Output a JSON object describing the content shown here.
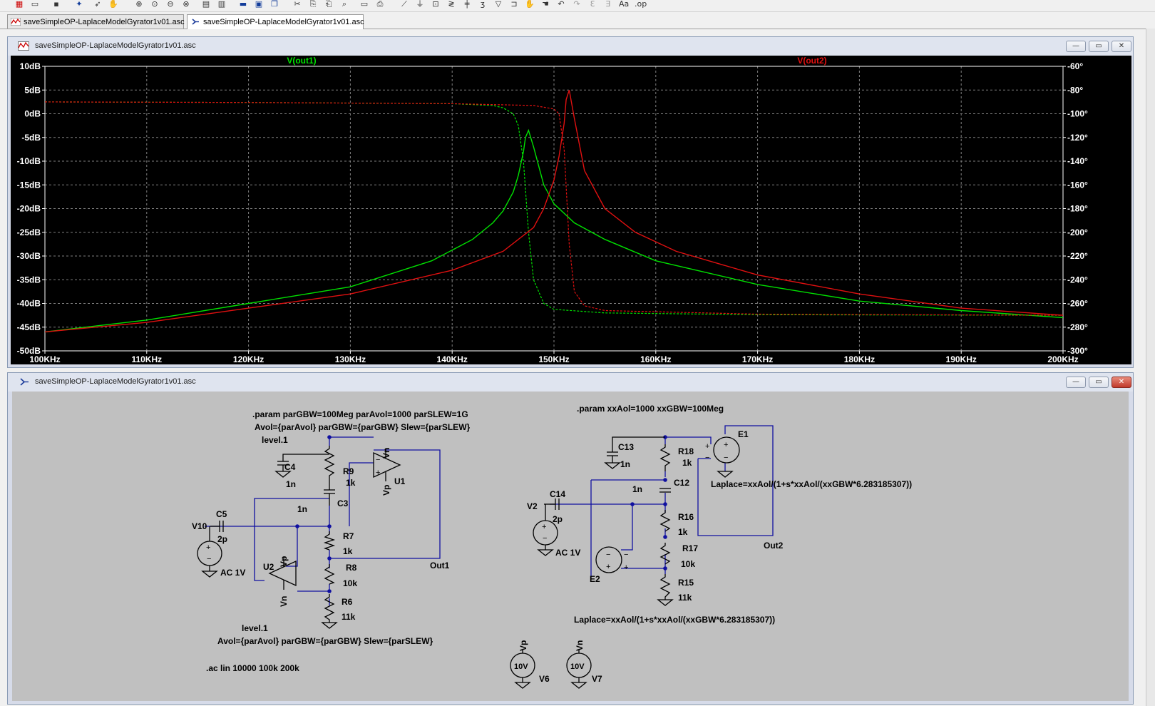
{
  "tabs": [
    {
      "label": "saveSimpleOP-LaplaceModelGyrator1v01.asc",
      "kind": "waveform"
    },
    {
      "label": "saveSimpleOP-LaplaceModelGyrator1v01.asc",
      "kind": "schematic"
    }
  ],
  "plot_window": {
    "title": "saveSimpleOP-LaplaceModelGyrator1v01.asc",
    "controls": {
      "minimize": "—",
      "restore": "▭",
      "close": "✕"
    }
  },
  "schematic_window": {
    "title": "saveSimpleOP-LaplaceModelGyrator1v01.asc",
    "controls": {
      "minimize": "—",
      "restore": "▭",
      "close": "✕"
    }
  },
  "colors": {
    "trace1": "#00e000",
    "trace2": "#e01010",
    "grid": "#808080",
    "axis_text": "#ffffff",
    "plot_bg": "#000000",
    "wire": "#1010a0",
    "schematic_bg": "#c0c0c0"
  },
  "chart_data": {
    "type": "line",
    "xlabel": "",
    "ylabel": "",
    "x_scale": "linear",
    "x_ticks": [
      "100KHz",
      "110KHz",
      "120KHz",
      "130KHz",
      "140KHz",
      "150KHz",
      "160KHz",
      "170KHz",
      "180KHz",
      "190KHz",
      "200KHz"
    ],
    "xlim": [
      100,
      200
    ],
    "y_ticks_left": [
      "10dB",
      "5dB",
      "0dB",
      "-5dB",
      "-10dB",
      "-15dB",
      "-20dB",
      "-25dB",
      "-30dB",
      "-35dB",
      "-40dB",
      "-45dB",
      "-50dB"
    ],
    "ylim_left": [
      -50,
      10
    ],
    "y_ticks_right": [
      "-60°",
      "-80°",
      "-100°",
      "-120°",
      "-140°",
      "-160°",
      "-180°",
      "-200°",
      "-220°",
      "-240°",
      "-260°",
      "-280°",
      "-300°"
    ],
    "ylim_right": [
      -300,
      -60
    ],
    "grid": true,
    "series": [
      {
        "name": "V(out1)",
        "color": "#00e000",
        "magnitude_db": {
          "x": [
            100,
            110,
            120,
            130,
            138,
            142,
            144,
            145,
            146,
            146.5,
            147,
            147.2,
            147.5,
            148,
            149,
            150,
            152,
            155,
            160,
            170,
            180,
            190,
            200
          ],
          "y": [
            -46,
            -43.5,
            -40,
            -36.5,
            -31,
            -26.5,
            -23,
            -20.5,
            -16.5,
            -13,
            -8,
            -5,
            -3.5,
            -7,
            -15,
            -19,
            -23,
            -26.5,
            -31,
            -36,
            -39.5,
            -41.5,
            -43
          ]
        },
        "phase_deg": {
          "x": [
            100,
            120,
            140,
            144,
            145,
            146,
            146.5,
            147,
            147.5,
            148,
            149,
            150,
            155,
            170,
            200
          ],
          "y": [
            -90,
            -90.5,
            -91.5,
            -93,
            -95,
            -100,
            -110,
            -140,
            -200,
            -240,
            -260,
            -265,
            -268,
            -269.5,
            -270
          ]
        }
      },
      {
        "name": "V(out2)",
        "color": "#e01010",
        "magnitude_db": {
          "x": [
            100,
            110,
            120,
            130,
            140,
            145,
            148,
            149,
            150,
            150.5,
            151,
            151.2,
            151.5,
            152,
            153,
            155,
            158,
            162,
            170,
            180,
            190,
            200
          ],
          "y": [
            -46,
            -44,
            -41,
            -38,
            -33,
            -29,
            -24,
            -20,
            -14,
            -9,
            -2,
            3,
            5,
            -1,
            -12,
            -20,
            -25,
            -29,
            -34,
            -38,
            -41,
            -42.5
          ]
        },
        "phase_deg": {
          "x": [
            100,
            120,
            140,
            148,
            150,
            150.5,
            151,
            151.5,
            152,
            153,
            155,
            170,
            200
          ],
          "y": [
            -90,
            -90.5,
            -91.5,
            -93,
            -96,
            -100,
            -130,
            -210,
            -250,
            -262,
            -266,
            -269,
            -270
          ]
        }
      }
    ]
  },
  "schematic": {
    "labels": {
      "param1": ".param parGBW=100Meg parAvol=1000 parSLEW=1G",
      "avol1": "Avol={parAvol} parGBW={parGBW} Slew={parSLEW}",
      "level1": "level.1",
      "level2": "level.1",
      "avol2": "Avol={parAvol} parGBW={parGBW} Slew={parSLEW}",
      "ac_cmd": ".ac lin 10000 100k 200k",
      "param2": ".param xxAol=1000 xxGBW=100Meg",
      "laplace1": "Laplace=xxAol/(1+s*xxAol/(xxGBW*6.283185307))",
      "laplace2": "Laplace=xxAol/(1+s*xxAol/(xxGBW*6.283185307))",
      "out1": "Out1",
      "out2": "Out2"
    },
    "components": {
      "C4": {
        "name": "C4",
        "value": "1n"
      },
      "R9": {
        "name": "R9",
        "value": "1k"
      },
      "C3": {
        "name": "C3",
        "value": "1n"
      },
      "C5": {
        "name": "C5",
        "value": "2p"
      },
      "V10": {
        "name": "V10",
        "value": "AC 1V"
      },
      "R7": {
        "name": "R7",
        "value": "1k"
      },
      "R8": {
        "name": "R8",
        "value": "10k"
      },
      "R6": {
        "name": "R6",
        "value": "11k"
      },
      "U1": {
        "name": "U1",
        "vn": "Vn",
        "vp": "Vp"
      },
      "U2": {
        "name": "U2",
        "vn": "Vn",
        "vp": "Vp"
      },
      "C13": {
        "name": "C13",
        "value": "1n"
      },
      "R18": {
        "name": "R18",
        "value": "1k"
      },
      "C12": {
        "name": "C12",
        "value": "1n"
      },
      "C14": {
        "name": "C14",
        "value": "2p"
      },
      "V2": {
        "name": "V2",
        "value": "AC 1V"
      },
      "R16": {
        "name": "R16",
        "value": "1k"
      },
      "R17": {
        "name": "R17",
        "value": "10k"
      },
      "R15": {
        "name": "R15",
        "value": "11k"
      },
      "E1": {
        "name": "E1"
      },
      "E2": {
        "name": "E2"
      },
      "V6": {
        "name": "V6",
        "value": "10V",
        "net": "Vp"
      },
      "V7": {
        "name": "V7",
        "value": "10V",
        "net": "Vn"
      }
    }
  }
}
